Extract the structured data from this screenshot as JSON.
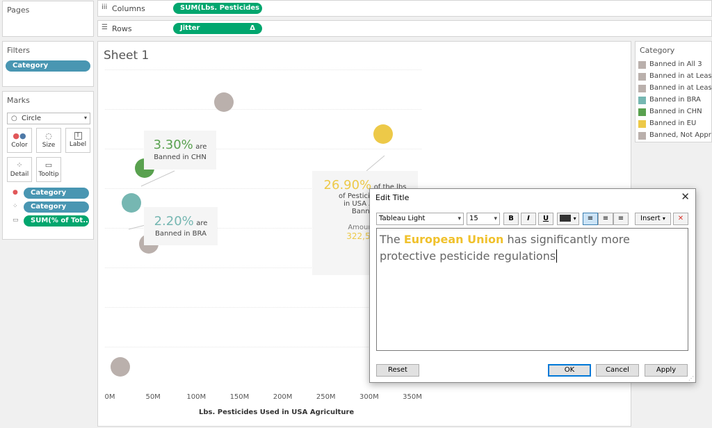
{
  "pages": {
    "title": "Pages"
  },
  "filters": {
    "title": "Filters",
    "pills": [
      "Category"
    ]
  },
  "marks": {
    "title": "Marks",
    "type": "Circle",
    "buttons": [
      {
        "name": "color",
        "label": "Color"
      },
      {
        "name": "size",
        "label": "Size"
      },
      {
        "name": "label",
        "label": "Label"
      },
      {
        "name": "detail",
        "label": "Detail"
      },
      {
        "name": "tooltip",
        "label": "Tooltip"
      }
    ],
    "cards": [
      {
        "icon": "color-icon",
        "label": "Category"
      },
      {
        "icon": "detail-icon",
        "label": "Category"
      },
      {
        "icon": "tooltip-icon",
        "label": "SUM(% of Tot.."
      }
    ]
  },
  "shelves": {
    "columns": {
      "label": "Columns",
      "pill": "SUM(Lbs. Pesticides .."
    },
    "rows": {
      "label": "Rows",
      "pill": "Jitter",
      "delta": "Δ"
    }
  },
  "sheet": {
    "title": "Sheet 1",
    "xaxis": {
      "title": "Lbs. Pesticides Used in USA Agriculture",
      "ticks": [
        "0M",
        "50M",
        "100M",
        "150M",
        "200M",
        "250M",
        "300M",
        "350M"
      ]
    },
    "annotations": {
      "chn": {
        "value": "3.30%",
        "suffix": "are",
        "line2": "Banned in CHN"
      },
      "bra": {
        "value": "2.20%",
        "suffix": "are",
        "line2": "Banned in BRA"
      },
      "eu": {
        "value": "26.90%",
        "suffix": "of the lbs",
        "line2": "of Pesticides th",
        "line3": "in USA Agric",
        "line4": "Banned",
        "amount_label": "Amount B",
        "amount_value": "322,597,"
      }
    }
  },
  "chart_data": {
    "type": "scatter",
    "xlabel": "Lbs. Pesticides Used in USA Agriculture",
    "x_ticks": [
      "0M",
      "50M",
      "100M",
      "150M",
      "200M",
      "250M",
      "300M",
      "350M"
    ],
    "xlim": [
      0,
      350
    ],
    "points": [
      {
        "category": "Banned, Not Approved",
        "x": 12,
        "y": 0.94,
        "color": "#bab0ac"
      },
      {
        "category": "Banned in BRA",
        "x": 25,
        "y": 0.42,
        "color": "#76b7b2"
      },
      {
        "category": "Banned in CHN",
        "x": 40,
        "y": 0.31,
        "color": "#59a14f"
      },
      {
        "category": "Banned in at Least",
        "x": 45,
        "y": 0.55,
        "color": "#bab0ac"
      },
      {
        "category": "Banned in All 3",
        "x": 132,
        "y": 0.1,
        "color": "#bab0ac"
      },
      {
        "category": "Banned in EU",
        "x": 316,
        "y": 0.2,
        "color": "#edc948"
      }
    ]
  },
  "legend": {
    "title": "Category",
    "items": [
      {
        "label": "Banned in All 3",
        "color": "#bab0ac"
      },
      {
        "label": "Banned in at Least",
        "color": "#bab0ac"
      },
      {
        "label": "Banned in at Least",
        "color": "#bab0ac"
      },
      {
        "label": "Banned in BRA",
        "color": "#76b7b2"
      },
      {
        "label": "Banned in CHN",
        "color": "#59a14f"
      },
      {
        "label": "Banned in EU",
        "color": "#edc948"
      },
      {
        "label": "Banned, Not Appro",
        "color": "#bab0ac"
      }
    ]
  },
  "dialog": {
    "title": "Edit Title",
    "close": "✕",
    "font": "Tableau Light",
    "size": "15",
    "bold": "B",
    "italic": "I",
    "underline": "U",
    "insert": "Insert",
    "clear": "✕",
    "text_before": "The ",
    "text_highlight": "European Union",
    "text_after": " has significantly more protective pesticide regulations",
    "highlight_color": "#f0c12c",
    "buttons": {
      "reset": "Reset",
      "ok": "OK",
      "cancel": "Cancel",
      "apply": "Apply"
    }
  }
}
